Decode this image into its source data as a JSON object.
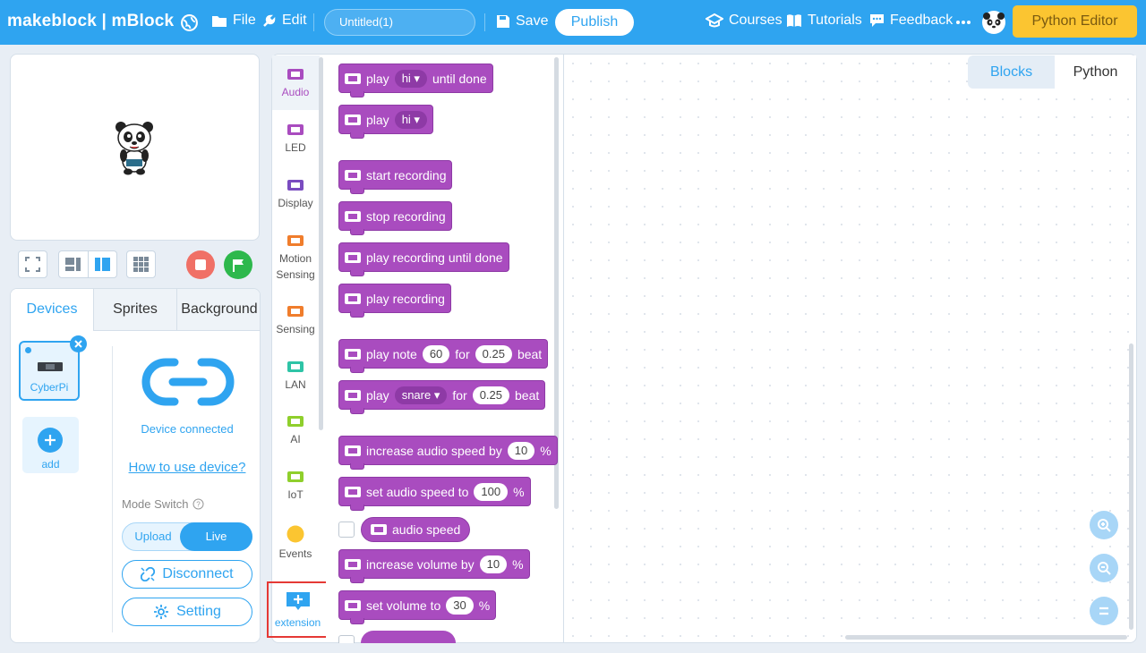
{
  "header": {
    "brand": "makeblock | mBlock",
    "menu_file": "File",
    "menu_edit": "Edit",
    "project_title": "Untitled(1)",
    "save_label": "Save",
    "publish_label": "Publish",
    "courses_label": "Courses",
    "tutorials_label": "Tutorials",
    "feedback_label": "Feedback",
    "python_editor_label": "Python Editor",
    "colors": {
      "bar": "#2fa4f0",
      "python_editor": "#fbc531"
    }
  },
  "stage": {
    "sprite": "panda-sprite"
  },
  "devices_panel": {
    "tabs": [
      "Devices",
      "Sprites",
      "Background"
    ],
    "device_name": "CyberPi",
    "add_label": "add",
    "status_text": "Device connected",
    "help_link": "How to use device?",
    "mode_switch_label": "Mode Switch",
    "mode_upload": "Upload",
    "mode_live": "Live",
    "disconnect_label": "Disconnect",
    "setting_label": "Setting"
  },
  "categories": [
    {
      "label": "Audio",
      "color": "#a94cbf"
    },
    {
      "label": "LED",
      "color": "#a94cbf"
    },
    {
      "label": "Display",
      "color": "#7a4cc0"
    },
    {
      "label": "Motion Sensing",
      "color": "#f07d2c"
    },
    {
      "label": "Sensing",
      "color": "#f07d2c"
    },
    {
      "label": "LAN",
      "color": "#2ec4a6"
    },
    {
      "label": "AI",
      "color": "#8fcf2c"
    },
    {
      "label": "IoT",
      "color": "#8fcf2c"
    },
    {
      "label": "Events",
      "color": "#fbc531"
    },
    {
      "label": "extension",
      "color": "#2fa4f0"
    }
  ],
  "blocks": {
    "b1": {
      "play": "play",
      "val": "hi",
      "tail": "until done"
    },
    "b2": {
      "play": "play",
      "val": "hi"
    },
    "b3": "start recording",
    "b4": "stop recording",
    "b5": "play recording until done",
    "b6": "play recording",
    "b7": {
      "a": "play note",
      "note": "60",
      "for": "for",
      "beat_val": "0.25",
      "beat": "beat"
    },
    "b8": {
      "a": "play",
      "drum": "snare",
      "for": "for",
      "beat_val": "0.25",
      "beat": "beat"
    },
    "b9": {
      "a": "increase audio speed by",
      "val": "10",
      "unit": "%"
    },
    "b10": {
      "a": "set audio speed to",
      "val": "100",
      "unit": "%"
    },
    "b11": "audio speed",
    "b12": {
      "a": "increase volume by",
      "val": "10",
      "unit": "%"
    },
    "b13": {
      "a": "set volume to",
      "val": "30",
      "unit": "%"
    }
  },
  "workspace": {
    "tab_blocks": "Blocks",
    "tab_python": "Python"
  }
}
